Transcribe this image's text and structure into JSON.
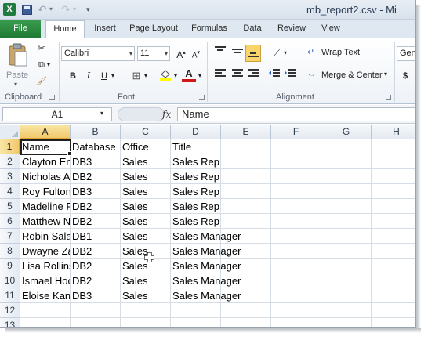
{
  "title_bar": {
    "app_icon_letter": "X",
    "window_title": "mb_report2.csv - Mi"
  },
  "tabs": [
    {
      "label": "File",
      "active": false
    },
    {
      "label": "Home",
      "active": true
    },
    {
      "label": "Insert",
      "active": false
    },
    {
      "label": "Page Layout",
      "active": false
    },
    {
      "label": "Formulas",
      "active": false
    },
    {
      "label": "Data",
      "active": false
    },
    {
      "label": "Review",
      "active": false
    },
    {
      "label": "View",
      "active": false
    }
  ],
  "ribbon": {
    "clipboard": {
      "label": "Clipboard",
      "paste_label": "Paste"
    },
    "font": {
      "label": "Font",
      "font_name": "Calibri",
      "font_size": "11",
      "bold": "B",
      "italic": "I",
      "underline": "U",
      "grow": "A",
      "shrink": "A",
      "font_color_glyph": "A"
    },
    "alignment": {
      "label": "Alignment",
      "wrap_text": "Wrap Text",
      "merge_center": "Merge & Center"
    },
    "number": {
      "format": "Gene",
      "currency": "$"
    }
  },
  "formula_bar": {
    "name_box": "A1",
    "fx": "fx",
    "content": "Name"
  },
  "sheet": {
    "columns": [
      "A",
      "B",
      "C",
      "D",
      "E",
      "F",
      "G",
      "H"
    ],
    "selected_column": "A",
    "selected_row": "1",
    "row_numbers": [
      "1",
      "2",
      "3",
      "4",
      "5",
      "6",
      "7",
      "8",
      "9",
      "10",
      "11",
      "12",
      "13"
    ],
    "header_row": [
      "Name",
      "Database",
      "Office",
      "Title"
    ],
    "rows": [
      [
        "Clayton En",
        "DB3",
        "Sales",
        "Sales Rep"
      ],
      [
        "Nicholas A",
        "DB2",
        "Sales",
        "Sales Rep"
      ],
      [
        "Roy Fulton",
        "DB3",
        "Sales",
        "Sales Rep"
      ],
      [
        "Madeline F",
        "DB2",
        "Sales",
        "Sales Rep"
      ],
      [
        "Matthew N",
        "DB2",
        "Sales",
        "Sales Rep"
      ],
      [
        "Robin Sala",
        "DB1",
        "Sales",
        "Sales Manager"
      ],
      [
        "Dwayne Za",
        "DB2",
        "Sales",
        "Sales Manager"
      ],
      [
        "Lisa Rollins",
        "DB2",
        "Sales",
        "Sales Manager"
      ],
      [
        "Ismael Hoc",
        "DB2",
        "Sales",
        "Sales Manager"
      ],
      [
        "Eloise Kan",
        "DB3",
        "Sales",
        "Sales Manager"
      ]
    ]
  },
  "colors": {
    "file_tab": "#2f8c44",
    "selection_header": "#f1c96b",
    "selection_border": "#1f1f1f"
  }
}
